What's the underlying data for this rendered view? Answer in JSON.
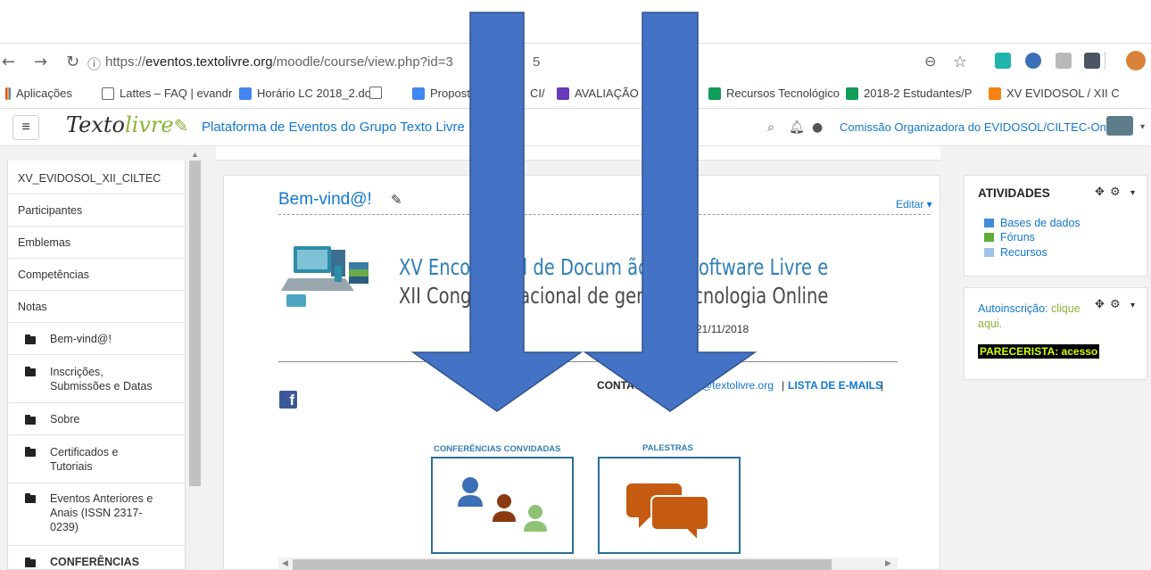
{
  "browser": {
    "url_prefix": "https://",
    "url_host": "eventos.textolivre.org",
    "url_path": "/moodle/course/view.php?id=3",
    "url_tail": "5",
    "bookmarks": [
      {
        "label": "Aplicações",
        "icon": "apps-icon"
      },
      {
        "label": "Lattes – FAQ | evandr",
        "icon": "page-icon"
      },
      {
        "label": "Horário LC 2018_2.do",
        "icon": "docs-icon"
      },
      {
        "label": "Propost",
        "icon": "docs-icon"
      },
      {
        "label": "CI/",
        "icon": "none"
      },
      {
        "label": "AVALIAÇÃO D",
        "icon": "forms-icon"
      },
      {
        "label": "Recursos Tecnológico",
        "icon": "sheets-icon"
      },
      {
        "label": "2018-2 Estudantes/P",
        "icon": "sheets-icon"
      },
      {
        "label": "XV EVIDOSOL / XII C",
        "icon": "moodle-icon"
      }
    ]
  },
  "navbar": {
    "menu_icon": "≡",
    "logo_text_a": "Texto",
    "logo_text_b": "livre",
    "site_name": "Plataforma de Eventos do Grupo Texto Livre",
    "user_name": "Comissão Organizadora do EVIDOSOL/CILTEC-Online"
  },
  "drawer": {
    "items": [
      "XV_EVIDOSOL_XII_CILTEC",
      "Participantes",
      "Emblemas",
      "Competências",
      "Notas"
    ],
    "sections": [
      {
        "label": "Bem-vind@!"
      },
      {
        "label": "Inscrições, Submissões e Datas"
      },
      {
        "label": "Sobre"
      },
      {
        "label": "Certificados e Tutoriais"
      },
      {
        "label": "Eventos Anteriores e Anais (ISSN 2317-0239)"
      },
      {
        "label": "CONFERÊNCIAS"
      }
    ]
  },
  "main": {
    "section_title": "Bem-vind@!",
    "edit_label": "Editar ▾",
    "banner_line1": "XV Encon        rtual de Docum             ão em Software Livre e",
    "banner_line2": "XII Congr           ternacional de          gem e Tecnologia Online",
    "dates": "a 21/11/2018",
    "contact_label": "CONTATO",
    "contact_email": "@textolivre.org",
    "sep": "|",
    "mailing_list": "LISTA DE E-MAILS",
    "sep_end": "|",
    "facebook": "f",
    "card1_caption": "CONFERÊNCIAS CONVIDADAS",
    "card2_caption": "PALESTRAS"
  },
  "blocks": {
    "atividades": {
      "title": "ATIVIDADES",
      "items": [
        "Bases de dados",
        "Fóruns",
        "Recursos"
      ]
    },
    "autoinscricao": {
      "text_a": "Autoinscrição: ",
      "text_b": "clique",
      "text_c": "aqui.",
      "badge": "PARECERISTA: acesso"
    }
  },
  "colors": {
    "link": "#1177d1",
    "arrow": "#4472c4",
    "arrow_stroke": "#2f528f",
    "box_border": "#2b6f97",
    "icon_orange": "#c55a11"
  }
}
